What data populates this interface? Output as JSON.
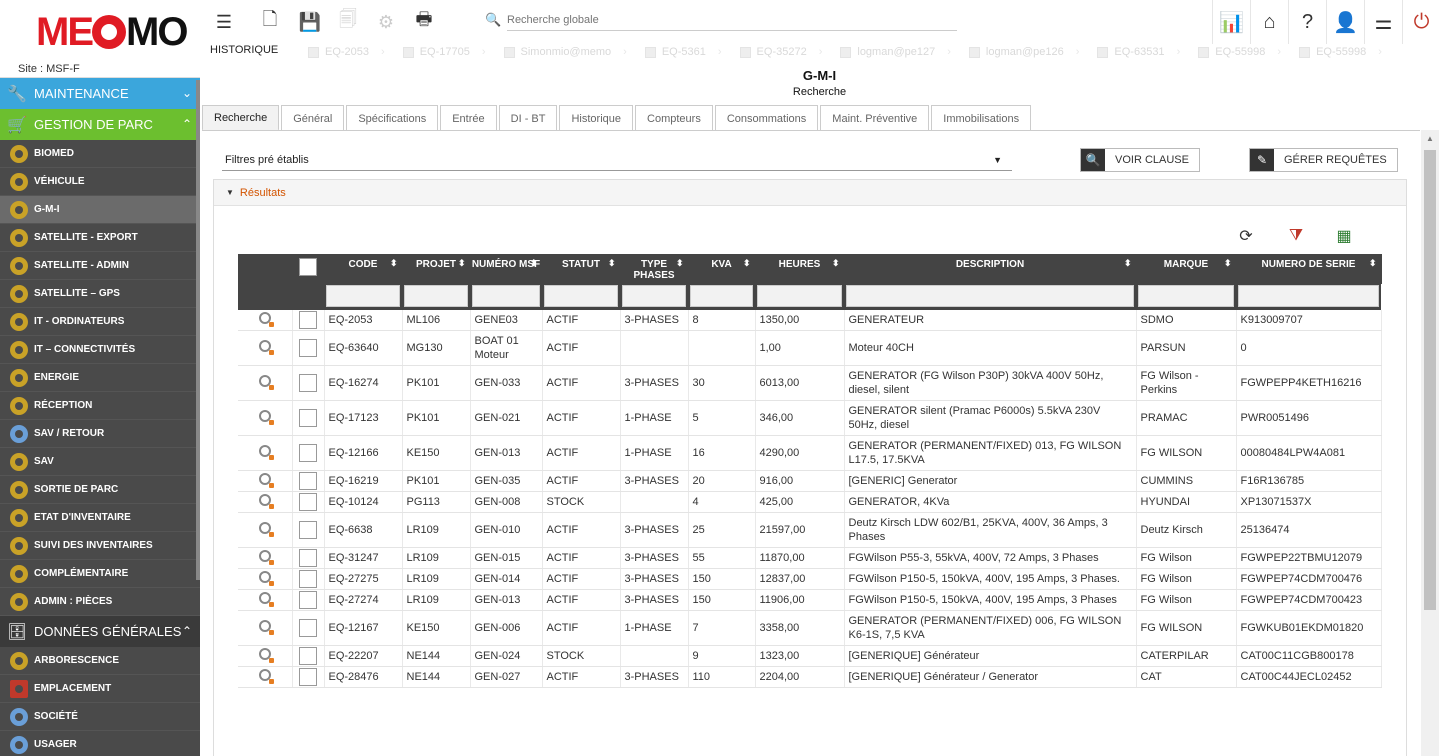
{
  "app": {
    "logo_text_1": "ME",
    "logo_text_2": "MO",
    "site": "Site :   MSF-F"
  },
  "sidebar": {
    "maintenance": "MAINTENANCE",
    "gestion_parc": "GESTION DE PARC",
    "parc_items": [
      {
        "label": "BIOMED",
        "icon": "gear-icon"
      },
      {
        "label": "VÉHICULE",
        "icon": "gear-icon"
      },
      {
        "label": "G-M-I",
        "icon": "gear-icon"
      },
      {
        "label": "SATELLITE - EXPORT",
        "icon": "gear-icon"
      },
      {
        "label": "SATELLITE - ADMIN",
        "icon": "gear-icon"
      },
      {
        "label": "SATELLITE – GPS",
        "icon": "gear-icon"
      },
      {
        "label": "IT - ORDINATEURS",
        "icon": "gear-icon"
      },
      {
        "label": "IT – CONNECTIVITÉS",
        "icon": "gear-icon"
      },
      {
        "label": "ENERGIE",
        "icon": "gear-icon"
      },
      {
        "label": "RÉCEPTION",
        "icon": "gear-icon"
      },
      {
        "label": "SAV / RETOUR",
        "icon": "person-icon"
      },
      {
        "label": "SAV",
        "icon": "gear-icon"
      },
      {
        "label": "SORTIE DE PARC",
        "icon": "gear-icon"
      },
      {
        "label": "ETAT D'INVENTAIRE",
        "icon": "gear-icon"
      },
      {
        "label": "SUIVI DES INVENTAIRES",
        "icon": "tree-icon"
      },
      {
        "label": "COMPLÉMENTAIRE",
        "icon": "gear-icon"
      },
      {
        "label": "ADMIN : PIÈCES",
        "icon": "gear-icon"
      }
    ],
    "donnees": "DONNÉES GÉNÉRALES",
    "donnees_items": [
      {
        "label": "ARBORESCENCE",
        "icon": "tree-icon"
      },
      {
        "label": "EMPLACEMENT",
        "icon": "shelf-icon"
      },
      {
        "label": "SOCIÉTÉ",
        "icon": "building-icon"
      },
      {
        "label": "USAGER",
        "icon": "user-icon"
      }
    ]
  },
  "toolbar": {
    "historique": "HISTORIQUE",
    "search_placeholder": "Recherche globale"
  },
  "history": [
    "EQ-2053",
    "EQ-17705",
    "Simonmio@memo",
    "EQ-5361",
    "EQ-35272",
    "logman@pe127",
    "logman@pe126",
    "EQ-63531",
    "EQ-55998",
    "EQ-55998"
  ],
  "page": {
    "title": "G-M-I",
    "subtitle": "Recherche"
  },
  "tabs": [
    "Recherche",
    "Général",
    "Spécifications",
    "Entrée",
    "DI - BT",
    "Historique",
    "Compteurs",
    "Consommations",
    "Maint. Préventive",
    "Immobilisations"
  ],
  "filters": {
    "preset": "Filtres pré établis",
    "voir_clause": "VOIR CLAUSE",
    "gerer_requetes": "GÉRER REQUÊTES"
  },
  "results": {
    "label": "Résultats",
    "columns": [
      "CODE",
      "PROJET",
      "NUMÉRO MSF",
      "STATUT",
      "TYPE PHASES",
      "KVA",
      "HEURES",
      "DESCRIPTION",
      "MARQUE",
      "NUMERO DE SERIE"
    ],
    "rows": [
      [
        "EQ-2053",
        "ML106",
        "GENE03",
        "ACTIF",
        "3-PHASES",
        "8",
        "1350,00",
        "GENERATEUR",
        "SDMO",
        "K913009707"
      ],
      [
        "EQ-63640",
        "MG130",
        "BOAT 01 Moteur",
        "ACTIF",
        "",
        "",
        "1,00",
        "Moteur 40CH",
        "PARSUN",
        "0"
      ],
      [
        "EQ-16274",
        "PK101",
        "GEN-033",
        "ACTIF",
        "3-PHASES",
        "30",
        "6013,00",
        "GENERATOR (FG Wilson P30P) 30kVA 400V 50Hz, diesel, silent",
        "FG Wilson - Perkins",
        "FGWPEPP4KETH16216"
      ],
      [
        "EQ-17123",
        "PK101",
        "GEN-021",
        "ACTIF",
        "1-PHASE",
        "5",
        "346,00",
        "GENERATOR silent (Pramac P6000s) 5.5kVA 230V 50Hz, diesel",
        "PRAMAC",
        "PWR0051496"
      ],
      [
        "EQ-12166",
        "KE150",
        "GEN-013",
        "ACTIF",
        "1-PHASE",
        "16",
        "4290,00",
        "GENERATOR (PERMANENT/FIXED) 013, FG WILSON L17.5, 17.5KVA",
        "FG WILSON",
        "00080484LPW4A081"
      ],
      [
        "EQ-16219",
        "PK101",
        "GEN-035",
        "ACTIF",
        "3-PHASES",
        "20",
        "916,00",
        "[GENERIC] Generator",
        "CUMMINS",
        "F16R136785"
      ],
      [
        "EQ-10124",
        "PG113",
        "GEN-008",
        "STOCK",
        "",
        "4",
        "425,00",
        "GENERATOR, 4KVa",
        "HYUNDAI",
        "XP13071537X"
      ],
      [
        "EQ-6638",
        "LR109",
        "GEN-010",
        "ACTIF",
        "3-PHASES",
        "25",
        "21597,00",
        "Deutz Kirsch LDW 602/B1, 25KVA, 400V, 36 Amps, 3 Phases",
        "Deutz Kirsch",
        "25136474"
      ],
      [
        "EQ-31247",
        "LR109",
        "GEN-015",
        "ACTIF",
        "3-PHASES",
        "55",
        "11870,00",
        "FGWilson P55-3, 55kVA, 400V, 72 Amps, 3 Phases",
        "FG Wilson",
        "FGWPEP22TBMU12079"
      ],
      [
        "EQ-27275",
        "LR109",
        "GEN-014",
        "ACTIF",
        "3-PHASES",
        "150",
        "12837,00",
        "FGWilson P150-5, 150kVA, 400V, 195 Amps, 3 Phases.",
        "FG Wilson",
        "FGWPEP74CDM700476"
      ],
      [
        "EQ-27274",
        "LR109",
        "GEN-013",
        "ACTIF",
        "3-PHASES",
        "150",
        "11906,00",
        "FGWilson P150-5, 150kVA, 400V, 195 Amps, 3 Phases",
        "FG Wilson",
        "FGWPEP74CDM700423"
      ],
      [
        "EQ-12167",
        "KE150",
        "GEN-006",
        "ACTIF",
        "1-PHASE",
        "7",
        "3358,00",
        "GENERATOR (PERMANENT/FIXED) 006, FG WILSON K6-1S, 7,5 KVA",
        "FG WILSON",
        "FGWKUB01EKDM01820"
      ],
      [
        "EQ-22207",
        "NE144",
        "GEN-024",
        "STOCK",
        "",
        "9",
        "1323,00",
        "[GENERIQUE] Générateur",
        "CATERPILAR",
        "CAT00C11CGB800178"
      ],
      [
        "EQ-28476",
        "NE144",
        "GEN-027",
        "ACTIF",
        "3-PHASES",
        "110",
        "2204,00",
        "[GENERIQUE] Générateur / Generator",
        "CAT",
        "CAT00C44JECL02452"
      ]
    ]
  },
  "colors": {
    "maintenance": "#3ba6dc",
    "gestion": "#6cbf2f",
    "accent": "#d35400"
  }
}
